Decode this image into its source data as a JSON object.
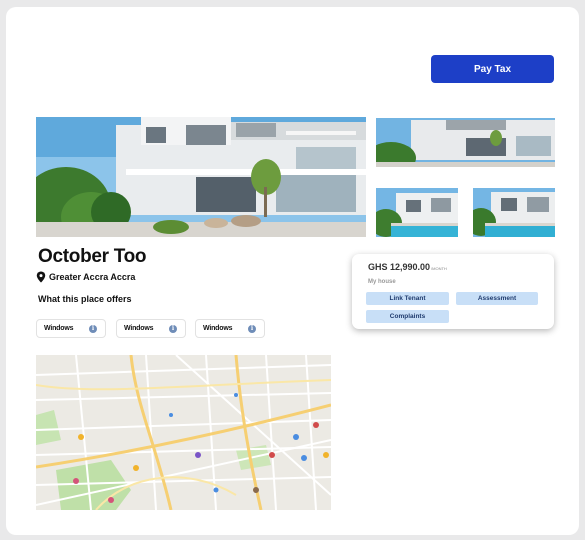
{
  "header": {
    "pay_tax_label": "Pay Tax"
  },
  "gallery": {
    "images": [
      {
        "name": "property-photo-main",
        "description": ""
      },
      {
        "name": "property-photo-thumb-1"
      },
      {
        "name": "property-photo-thumb-2"
      },
      {
        "name": "property-photo-thumb-3"
      }
    ]
  },
  "property": {
    "title": "October Too",
    "location": "Greater Accra Accra",
    "offers_heading": "What this place offers",
    "amenities": [
      {
        "label": "Windows",
        "info": "i"
      },
      {
        "label": "Windows",
        "info": "i"
      },
      {
        "label": "Windows",
        "info": "i"
      }
    ]
  },
  "price_card": {
    "price": "GHS 12,990.00",
    "unit": "/MONTH",
    "section_label": "My house",
    "actions": {
      "link_tenant": "Link Tenant",
      "assessment": "Assessment",
      "complaints": "Complaints"
    }
  },
  "colors": {
    "primary_button": "#1d3fc7",
    "pill_background": "#c8dff7",
    "pill_text": "#1f3b6e",
    "page_background": "#e9e9ea"
  },
  "icons": {
    "location": "map-pin-icon",
    "amenity_info": "info-icon"
  }
}
